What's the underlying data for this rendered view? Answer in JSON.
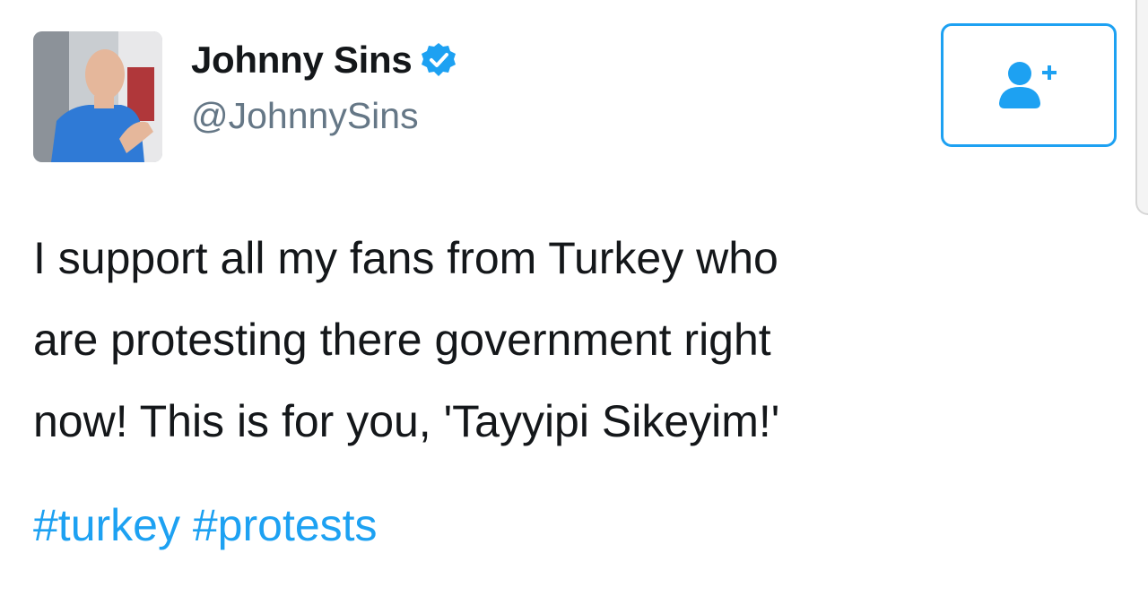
{
  "header": {
    "display_name": "Johnny Sins",
    "handle": "@JohnnySins",
    "verified": true,
    "avatar_icon": "user-photo",
    "verified_icon": "verified-badge-icon"
  },
  "follow_button": {
    "icon": "follow-user-icon"
  },
  "tweet": {
    "lines": [
      "I support all my fans from Turkey who",
      "are protesting there government right",
      "now! This is for you, 'Tayyipi Sikeyim!'"
    ],
    "hashtags": [
      "#turkey",
      "#protests"
    ]
  },
  "colors": {
    "accent": "#1da1f2",
    "text": "#14171a",
    "secondary_text": "#657786"
  }
}
